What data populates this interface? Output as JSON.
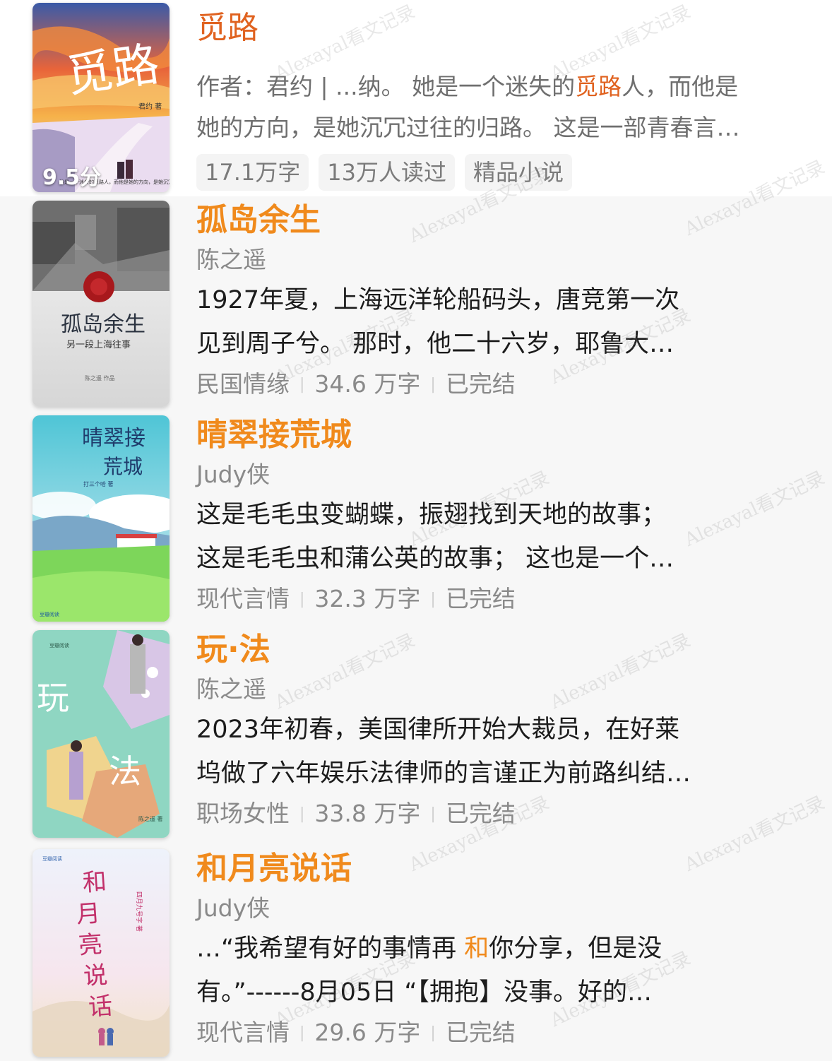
{
  "watermark_text": "Alexayal看文记录",
  "books": [
    {
      "title": "觅路",
      "author_line": "作者：君约 | ...纳。",
      "desc_line1_a": " 她是一个迷失的",
      "desc_line1_hl": "觅路",
      "desc_line1_b": "人，而他是",
      "desc_line2": "她的方向，是她沉冗过往的归路。 这是一部青春言…",
      "score": "9.5分",
      "tags": [
        "17.1万字",
        "13万人读过",
        "精品小说"
      ],
      "cover_title": "觅路",
      "cover_author": "君约 著",
      "cover_caption": "她是一个迷失的觅路人，而他是她的方向，是她沉冗过往的归路。"
    },
    {
      "title": "孤岛余生",
      "author": "陈之遥",
      "desc_line1": "1927年夏，上海远洋轮船码头，唐竞第一次",
      "desc_line2": "见到周子兮。 那时，他二十六岁，耶鲁大…",
      "meta": [
        "民国情缘",
        "34.6 万字",
        "已完结"
      ],
      "cover_title": "孤岛余生",
      "cover_subtitle": "另一段上海往事",
      "cover_author": "陈之遥 作品"
    },
    {
      "title": "晴翠接荒城",
      "author": "Judy侠",
      "desc_line1": "这是毛毛虫变蝴蝶，振翅找到天地的故事；",
      "desc_line2": "这是毛毛虫和蒲公英的故事； 这也是一个…",
      "meta": [
        "现代言情",
        "32.3 万字",
        "已完结"
      ],
      "cover_title_a": "晴翠接",
      "cover_title_b": "荒城",
      "cover_author": "打三个哈 著",
      "cover_brand": "豆瓣阅读"
    },
    {
      "title": "玩·法",
      "author": "陈之遥",
      "desc_line1": "2023年初春，美国律所开始大裁员，在好莱",
      "desc_line2": "坞做了六年娱乐法律师的言谨正为前路纠结…",
      "meta": [
        "职场女性",
        "33.8 万字",
        "已完结"
      ],
      "cover_title_a": "玩",
      "cover_title_b": "法",
      "cover_author": "陈之遥 著",
      "cover_brand": "豆瓣阅读"
    },
    {
      "title": "和月亮说话",
      "author": "Judy侠",
      "desc_line1_a": "…“我希望有好的事情再 ",
      "desc_line1_hl": "和",
      "desc_line1_b": "你分享，但是没",
      "desc_line2": "有。”------8月05日 “【拥抱】没事。好的…",
      "meta": [
        "现代言情",
        "29.6 万字",
        "已完结"
      ],
      "cover_title": "和月亮说话",
      "cover_author": "四月九号字 著",
      "cover_brand": "豆瓣阅读"
    }
  ]
}
